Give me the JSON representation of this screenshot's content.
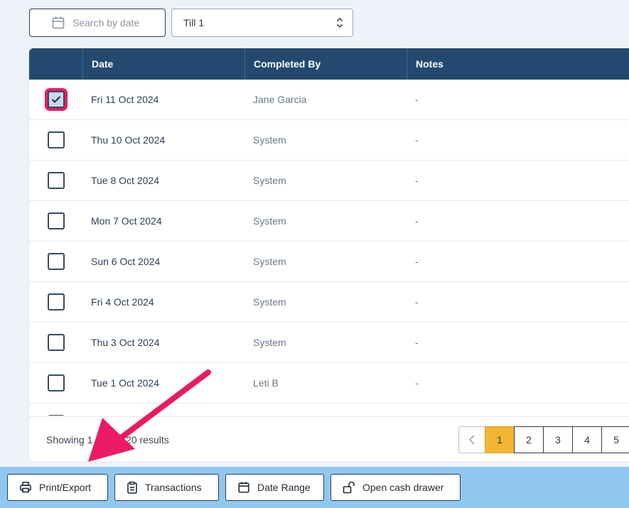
{
  "filters": {
    "date_placeholder": "Search by date",
    "till_value": "Till 1"
  },
  "table": {
    "headers": [
      "Date",
      "Completed By",
      "Notes"
    ],
    "rows": [
      {
        "date": "Fri 11 Oct 2024",
        "by": "Jane Garcia",
        "notes": "-",
        "checked": true
      },
      {
        "date": "Thu 10 Oct 2024",
        "by": "System",
        "notes": "-",
        "checked": false
      },
      {
        "date": "Tue 8 Oct 2024",
        "by": "System",
        "notes": "-",
        "checked": false
      },
      {
        "date": "Mon 7 Oct 2024",
        "by": "System",
        "notes": "-",
        "checked": false
      },
      {
        "date": "Sun 6 Oct 2024",
        "by": "System",
        "notes": "-",
        "checked": false
      },
      {
        "date": "Fri 4 Oct 2024",
        "by": "System",
        "notes": "-",
        "checked": false
      },
      {
        "date": "Thu 3 Oct 2024",
        "by": "System",
        "notes": "-",
        "checked": false
      },
      {
        "date": "Tue 1 Oct 2024",
        "by": "Leti B",
        "notes": "-",
        "checked": false
      }
    ]
  },
  "footer": {
    "showing_text": "Showing 1          520 results",
    "pages": [
      "1",
      "2",
      "3",
      "4",
      "5"
    ],
    "active_page": "1"
  },
  "actions": {
    "print_export": "Print/Export",
    "transactions": "Transactions",
    "date_range": "Date Range",
    "open_cash_drawer": "Open cash drawer"
  },
  "colors": {
    "header_bg": "#234a6e",
    "highlight": "#ea1b64",
    "active_page": "#f2b633",
    "bottom_bar": "#8ec8f0"
  }
}
